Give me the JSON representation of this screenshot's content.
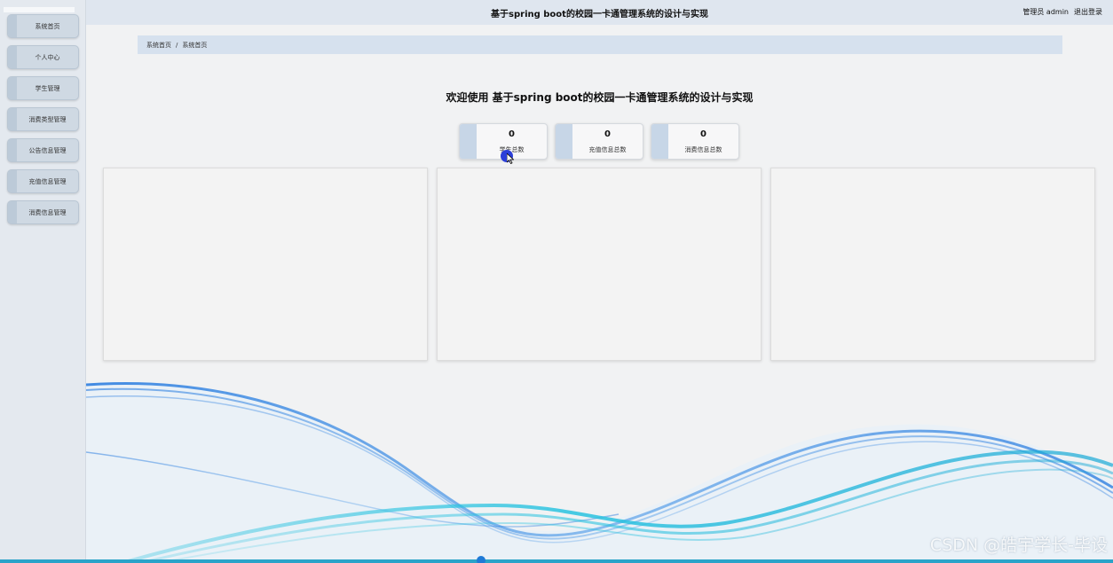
{
  "app": {
    "title": "基于spring boot的校园一卡通管理系统的设计与实现"
  },
  "header": {
    "user_text": "管理员 admin",
    "logout_label": "退出登录"
  },
  "sidebar": {
    "items": [
      {
        "label": "系统首页"
      },
      {
        "label": "个人中心"
      },
      {
        "label": "学生管理"
      },
      {
        "label": "消费类型管理"
      },
      {
        "label": "公告信息管理"
      },
      {
        "label": "充值信息管理"
      },
      {
        "label": "消费信息管理"
      }
    ]
  },
  "breadcrumb": {
    "home": "系统首页",
    "separator": "/",
    "current": "系统首页"
  },
  "welcome": {
    "text": "欢迎使用 基于spring boot的校园一卡通管理系统的设计与实现"
  },
  "stats": [
    {
      "value": "0",
      "label": "学生总数"
    },
    {
      "value": "0",
      "label": "充值信息总数"
    },
    {
      "value": "0",
      "label": "消费信息总数"
    }
  ],
  "watermark": "CSDN @皓宇学长-毕设",
  "colors": {
    "sidebar_bg": "#e4e9ef",
    "header_bg": "#dfe6ef",
    "wave_blue": "#2f7fe0",
    "wave_cyan": "#29c3e0"
  }
}
